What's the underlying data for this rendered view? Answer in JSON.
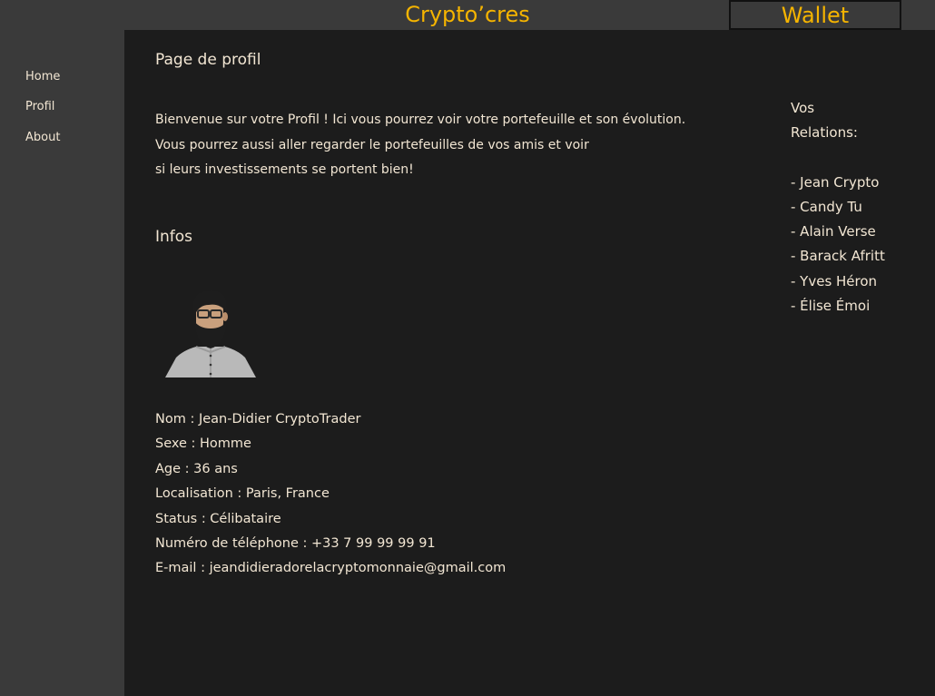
{
  "header": {
    "brand": "Crypto’cres",
    "wallet_label": "Wallet"
  },
  "sidebar": {
    "items": [
      {
        "label": "Home"
      },
      {
        "label": "Profil"
      },
      {
        "label": "About"
      }
    ]
  },
  "main": {
    "page_title": "Page de profil",
    "intro_lines": [
      "Bienvenue sur votre Profil ! Ici vous pourrez voir votre portefeuille et son évolution.",
      "Vous pourrez aussi aller regarder le portefeuilles de vos amis et voir",
      "si leurs investissements se portent bien!"
    ],
    "infos_title": "Infos",
    "details": [
      "Nom : Jean-Didier CryptoTrader",
      "Sexe : Homme",
      "Age : 36 ans",
      "Localisation : Paris, France",
      "Status : Célibataire",
      "Numéro de téléphone : +33 7 99 99 99 91",
      "E-mail : jeandidieradorelacryptomonnaie@gmail.com"
    ]
  },
  "relations": {
    "heading_line1": "Vos",
    "heading_line2": "Relations:",
    "items": [
      "- Jean Crypto",
      "- Candy Tu",
      "- Alain Verse",
      "- Barack Afritt",
      "- Yves Héron",
      "- Élise Émoi"
    ]
  },
  "colors": {
    "accent": "#f5b400",
    "background": "#1c1c1c",
    "panel": "#3a3a3a",
    "text": "#f2e6d3"
  }
}
